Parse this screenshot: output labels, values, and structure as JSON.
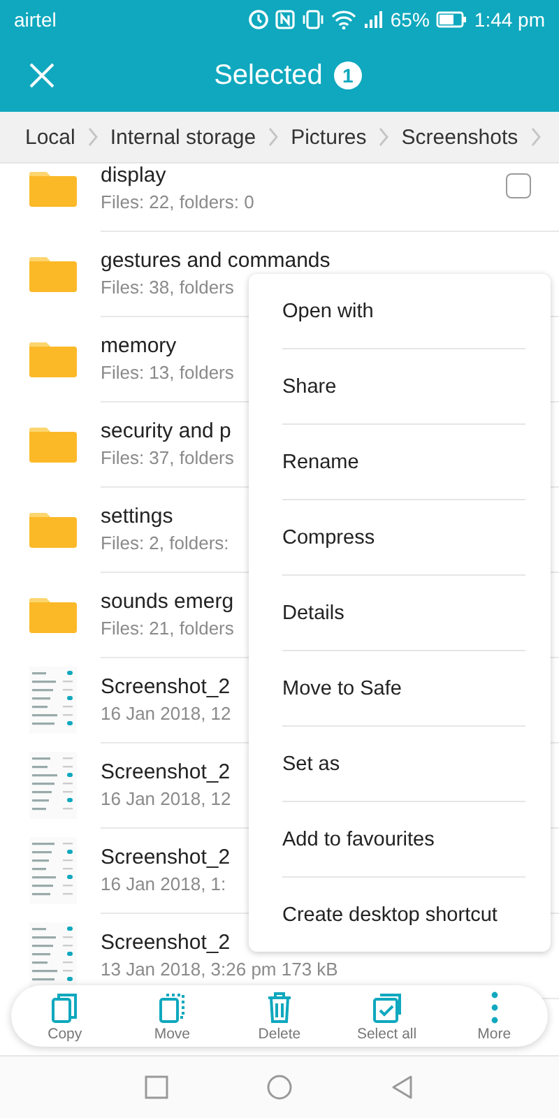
{
  "status_bar": {
    "carrier": "airtel",
    "battery": "65%",
    "time": "1:44 pm"
  },
  "header": {
    "title": "Selected",
    "count": "1"
  },
  "breadcrumb": [
    "Local",
    "Internal storage",
    "Pictures",
    "Screenshots"
  ],
  "files": [
    {
      "kind": "folder",
      "name": "display",
      "details": "Files: 22, folders: 0",
      "checked": false
    },
    {
      "kind": "folder",
      "name": "gestures and commands",
      "details": "Files: 38, folders"
    },
    {
      "kind": "folder",
      "name": "memory",
      "details": "Files: 13, folders"
    },
    {
      "kind": "folder",
      "name": "security and p",
      "details": "Files: 37, folders"
    },
    {
      "kind": "folder",
      "name": "settings",
      "details": "Files: 2, folders:"
    },
    {
      "kind": "folder",
      "name": "sounds emerg",
      "details": "Files: 21, folders"
    },
    {
      "kind": "image",
      "name": "Screenshot_2",
      "details": "16 Jan 2018, 12"
    },
    {
      "kind": "image",
      "name": "Screenshot_2",
      "details": "16 Jan 2018, 12"
    },
    {
      "kind": "image",
      "name": "Screenshot_2",
      "details": "16 Jan 2018, 1:"
    },
    {
      "kind": "image",
      "name": "Screenshot_2",
      "details": "13 Jan 2018, 3:26 pm 173 kB"
    }
  ],
  "context_menu": [
    "Open with",
    "Share",
    "Rename",
    "Compress",
    "Details",
    "Move to Safe",
    "Set as",
    "Add to favourites",
    "Create desktop shortcut"
  ],
  "action_bar": [
    {
      "kind": "copy",
      "label": "Copy"
    },
    {
      "kind": "move",
      "label": "Move"
    },
    {
      "kind": "delete",
      "label": "Delete"
    },
    {
      "kind": "select_all",
      "label": "Select all"
    },
    {
      "kind": "more",
      "label": "More"
    }
  ]
}
